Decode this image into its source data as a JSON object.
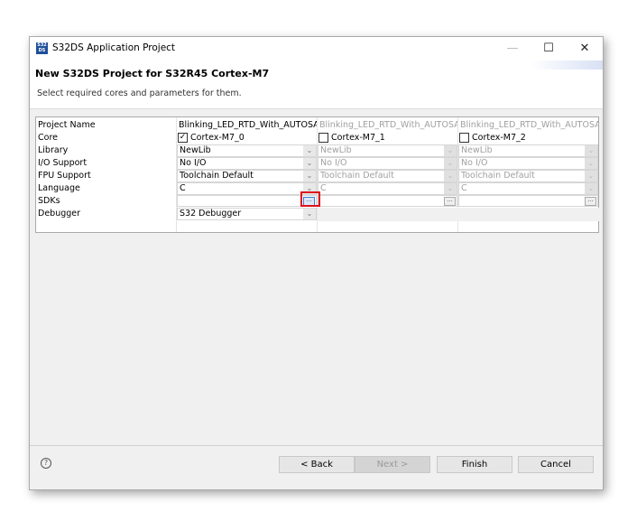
{
  "window": {
    "title": "S32DS Application Project",
    "logo_text": "S32 DS",
    "minimize": "—",
    "maximize": "☐",
    "close": "✕"
  },
  "header": {
    "title": "New S32DS Project for S32R45 Cortex-M7",
    "subtitle": "Select required cores and parameters for them."
  },
  "table": {
    "row_labels": [
      "Project Name",
      "Core",
      "Library",
      "I/O Support",
      "FPU Support",
      "Language",
      "SDKs",
      "Debugger"
    ],
    "columns": [
      {
        "project_name": "Blinking_LED_RTD_With_AUTOSAR_",
        "core": "Cortex-M7_0",
        "checked": true,
        "library": "NewLib",
        "io": "No I/O",
        "fpu": "Toolchain Default",
        "language": "C",
        "debugger": "S32 Debugger",
        "enabled": true
      },
      {
        "project_name": "Blinking_LED_RTD_With_AUTOSAR_",
        "core": "Cortex-M7_1",
        "checked": false,
        "library": "NewLib",
        "io": "No I/O",
        "fpu": "Toolchain Default",
        "language": "C",
        "enabled": false
      },
      {
        "project_name": "Blinking_LED_RTD_With_AUTOSAR_",
        "core": "Cortex-M7_2",
        "checked": false,
        "library": "NewLib",
        "io": "No I/O",
        "fpu": "Toolchain Default",
        "language": "C",
        "enabled": false
      }
    ],
    "browse_label": "...",
    "highlight_color": "#e0101a"
  },
  "footer": {
    "help": "?",
    "back": "< Back",
    "next": "Next >",
    "finish": "Finish",
    "cancel": "Cancel"
  }
}
